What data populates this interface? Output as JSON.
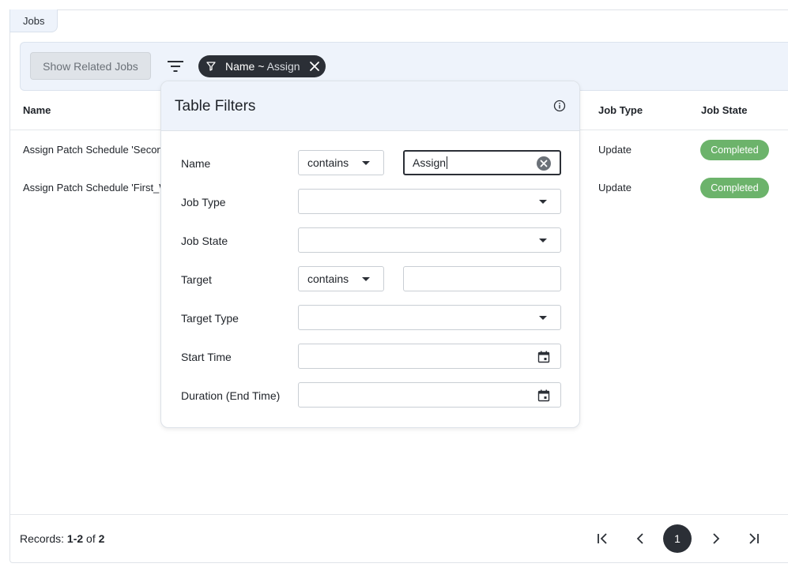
{
  "tab": {
    "label": "Jobs"
  },
  "toolbar": {
    "related_button": "Show Related Jobs",
    "chip": {
      "field": "Name",
      "operator": "~",
      "value": "Assign"
    }
  },
  "table": {
    "columns": [
      "Name",
      "Job Type",
      "Job State"
    ],
    "rows": [
      {
        "name": "Assign Patch Schedule 'Secon",
        "job_type": "Update",
        "job_state": "Completed"
      },
      {
        "name": "Assign Patch Schedule 'First_W",
        "job_type": "Update",
        "job_state": "Completed"
      }
    ]
  },
  "footer": {
    "records_prefix": "Records:",
    "records_range": "1-2",
    "records_of": "of",
    "records_total": "2",
    "current_page": "1"
  },
  "filters": {
    "title": "Table Filters",
    "fields": [
      {
        "label": "Name",
        "operator": "contains",
        "value": "Assign"
      },
      {
        "label": "Job Type"
      },
      {
        "label": "Job State"
      },
      {
        "label": "Target",
        "operator": "contains",
        "value": ""
      },
      {
        "label": "Target Type"
      },
      {
        "label": "Start Time"
      },
      {
        "label": "Duration (End Time)"
      }
    ]
  },
  "colors": {
    "badge": "#6cb36b",
    "dark": "#2b2f36",
    "panel": "#eef3fb"
  }
}
